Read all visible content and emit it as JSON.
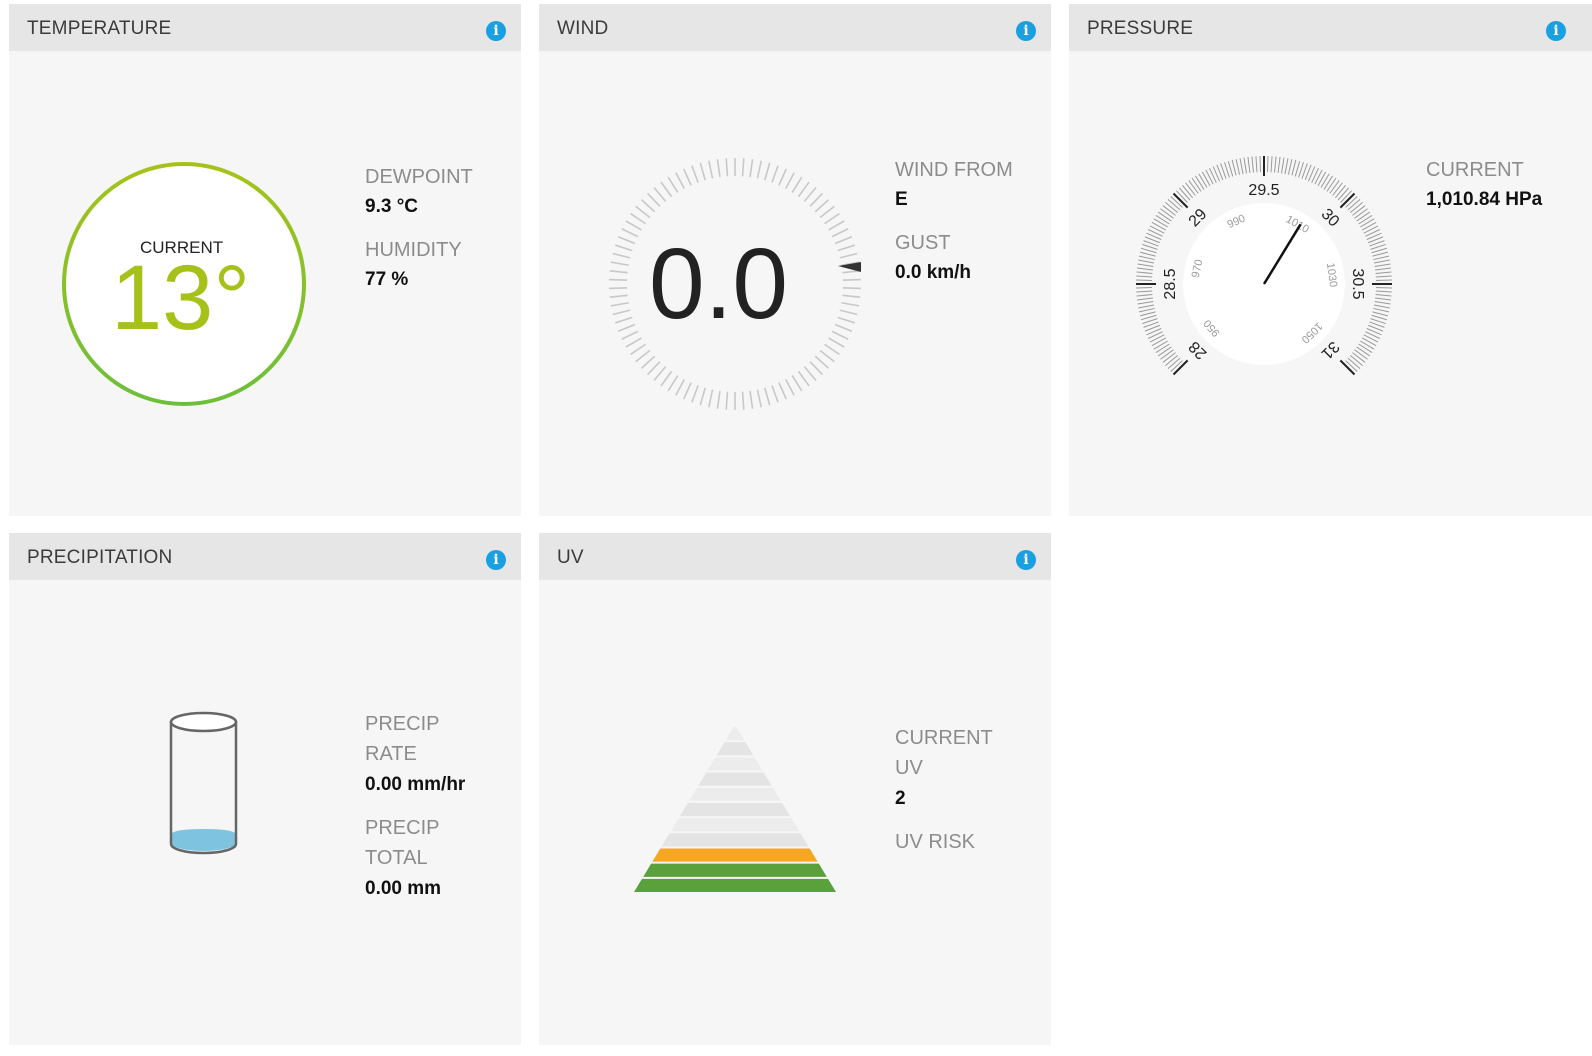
{
  "temperature": {
    "title": "TEMPERATURE",
    "current_label": "CURRENT",
    "current_value": "13°",
    "dewpoint_label": "DEWPOINT",
    "dewpoint_value": "9.3 °C",
    "humidity_label": "HUMIDITY",
    "humidity_value": "77 %",
    "ring_color": "#8cc63f"
  },
  "wind": {
    "title": "WIND",
    "speed_value": "0.0",
    "from_label": "WIND FROM",
    "from_value": "E",
    "gust_label": "GUST",
    "gust_value": "0.0 km/h",
    "direction": "E"
  },
  "pressure": {
    "title": "PRESSURE",
    "current_label": "CURRENT",
    "current_value": "1,010.84 HPa",
    "outer_ticks": [
      "28",
      "28.5",
      "29",
      "29.5",
      "30",
      "30.5",
      "31"
    ],
    "inner_ticks": [
      "950",
      "970",
      "990",
      "1010",
      "1030",
      "1050"
    ],
    "needle_hpa": 1010.84
  },
  "precipitation": {
    "title": "PRECIPITATION",
    "rate_label_1": "PRECIP",
    "rate_label_2": "RATE",
    "rate_value": "0.00 mm/hr",
    "total_label_1": "PRECIP",
    "total_label_2": "TOTAL",
    "total_value": "0.00 mm",
    "water_color": "#7ec4e0"
  },
  "uv": {
    "title": "UV",
    "current_label_1": "CURRENT",
    "current_label_2": "UV",
    "current_value": "2",
    "risk_label": "UV RISK",
    "risk_value": "",
    "filled_levels": 3,
    "level_colors": [
      "#5aa13c",
      "#5aa13c",
      "#f5a623"
    ]
  },
  "icons": {
    "info": "i"
  }
}
